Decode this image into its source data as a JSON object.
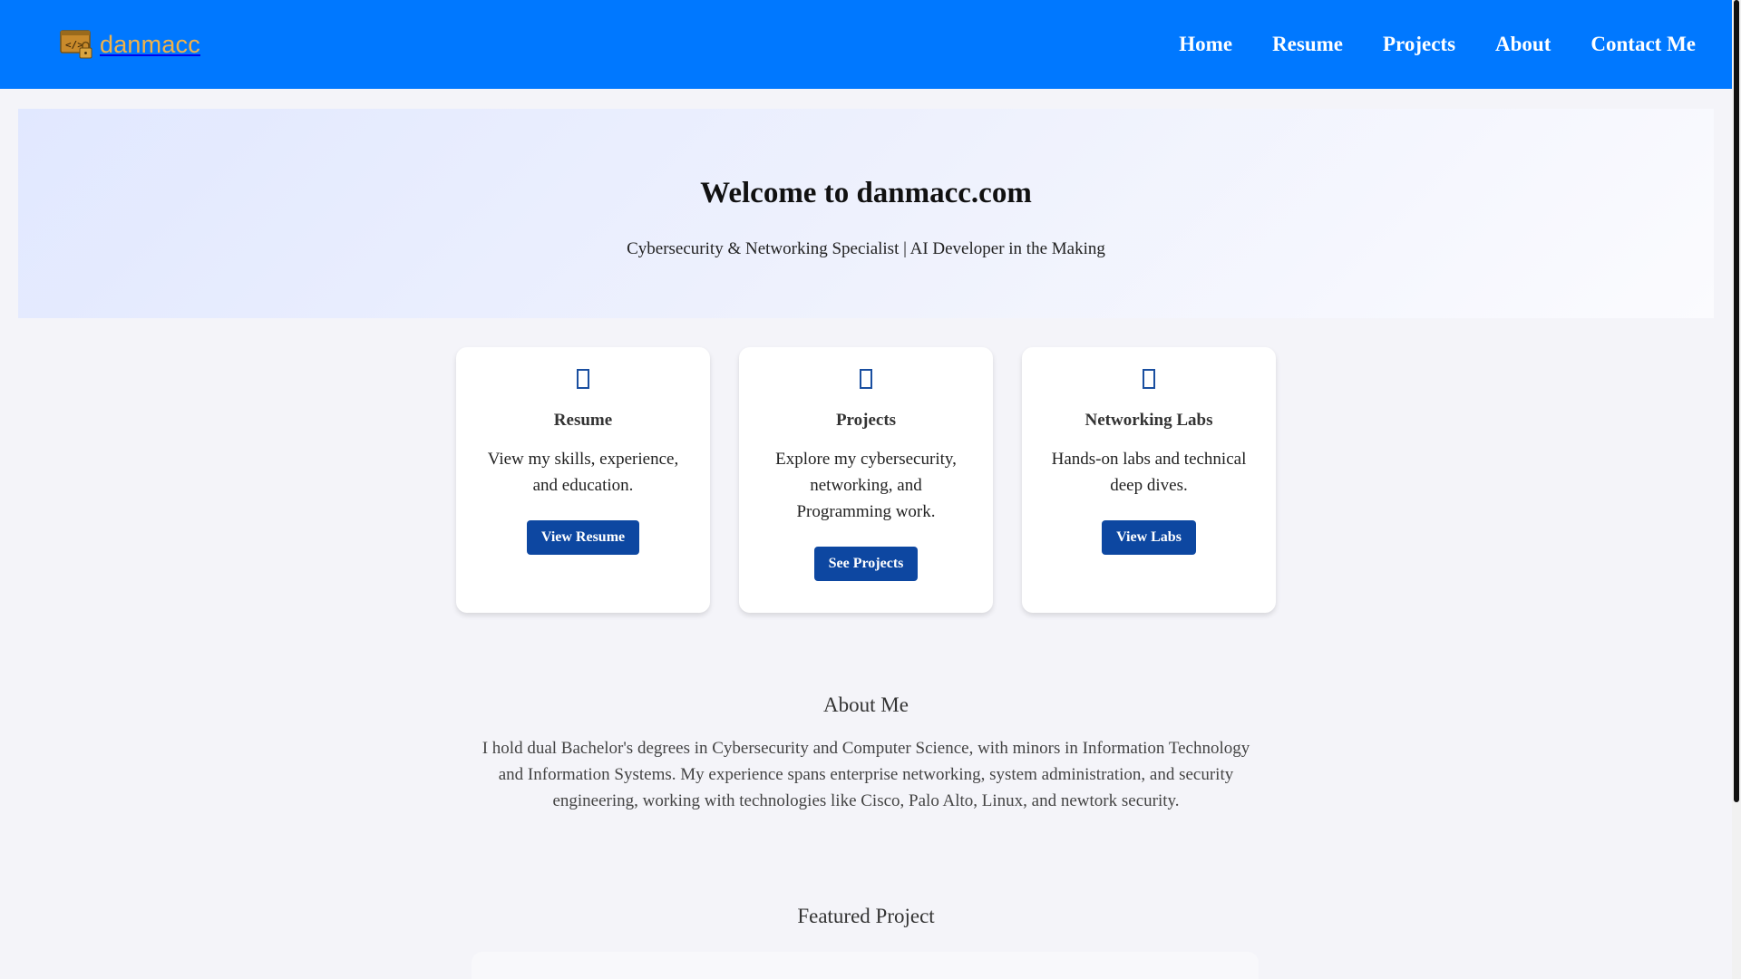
{
  "header": {
    "logo_text": "danmacc",
    "nav": [
      {
        "label": "Home"
      },
      {
        "label": "Resume"
      },
      {
        "label": "Projects"
      },
      {
        "label": "About"
      },
      {
        "label": "Contact Me"
      }
    ]
  },
  "hero": {
    "title": "Welcome to danmacc.com",
    "subtitle": "Cybersecurity & Networking Specialist | AI Developer in the Making"
  },
  "cards": [
    {
      "icon": "file-icon",
      "title": "Resume",
      "description": "View my skills, experience, and education.",
      "button": "View Resume"
    },
    {
      "icon": "folder-icon",
      "title": "Projects",
      "description": "Explore my cybersecurity, networking, and Programming work.",
      "button": "See Projects"
    },
    {
      "icon": "network-icon",
      "title": "Networking Labs",
      "description": "Hands-on labs and technical deep dives.",
      "button": "View Labs"
    }
  ],
  "about": {
    "heading": "About Me",
    "body": "I hold dual Bachelor's degrees in Cybersecurity and Computer Science, with minors in Information Technology and Information Systems. My experience spans enterprise networking, system administration, and security engineering, working with technologies like Cisco, Palo Alto, Linux, and newtork security."
  },
  "featured": {
    "heading": "Featured Project"
  },
  "colors": {
    "header_bg": "#0078ff",
    "logo_text": "#f0b24a",
    "button_bg": "#0d47a1",
    "page_bg": "#f4f4f9"
  }
}
